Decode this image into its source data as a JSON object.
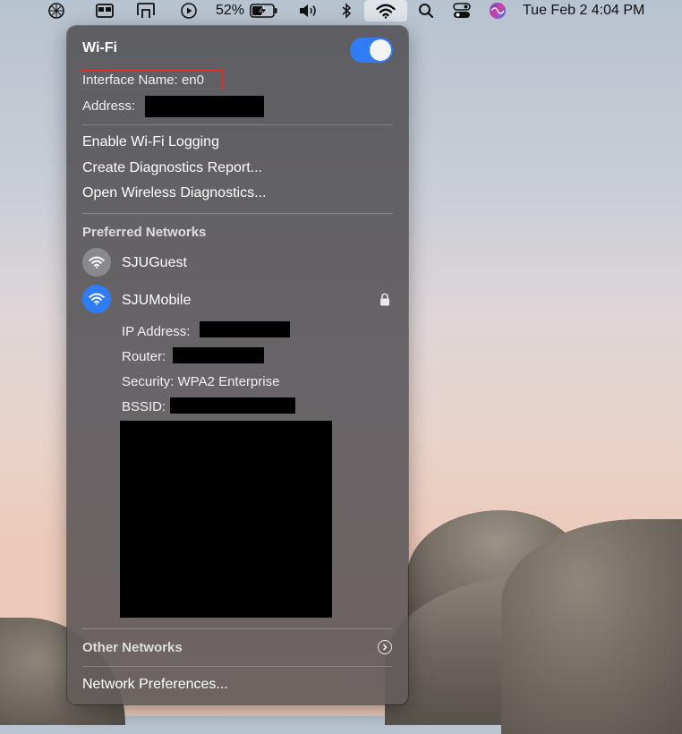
{
  "menubar": {
    "battery_percent": "52%",
    "datetime": "Tue Feb 2  4:04 PM",
    "icons": [
      "app-icon",
      "screen-mirroring-icon",
      "display-icon",
      "play-icon",
      "battery-icon",
      "volume-icon",
      "bluetooth-icon",
      "wifi-icon",
      "spotlight-search-icon",
      "control-center-icon",
      "siri-icon"
    ]
  },
  "wifi_menu": {
    "title": "Wi-Fi",
    "toggle_on": true,
    "interface_name": "Interface Name: en0",
    "address_label": "Address:",
    "actions": [
      "Enable Wi-Fi Logging",
      "Create Diagnostics Report...",
      "Open Wireless Diagnostics..."
    ],
    "preferred_header": "Preferred Networks",
    "networks": [
      {
        "name": "SJUGuest",
        "connected": false,
        "locked": false
      },
      {
        "name": "SJUMobile",
        "connected": true,
        "locked": true
      }
    ],
    "details": {
      "ip_label": "IP Address:",
      "router_label": "Router:",
      "security": "Security: WPA2 Enterprise",
      "bssid_label": "BSSID:"
    },
    "other_networks": "Other Networks",
    "network_prefs": "Network Preferences..."
  },
  "colors": {
    "accent": "#2f7cf6",
    "highlight_box": "#e0322a"
  }
}
